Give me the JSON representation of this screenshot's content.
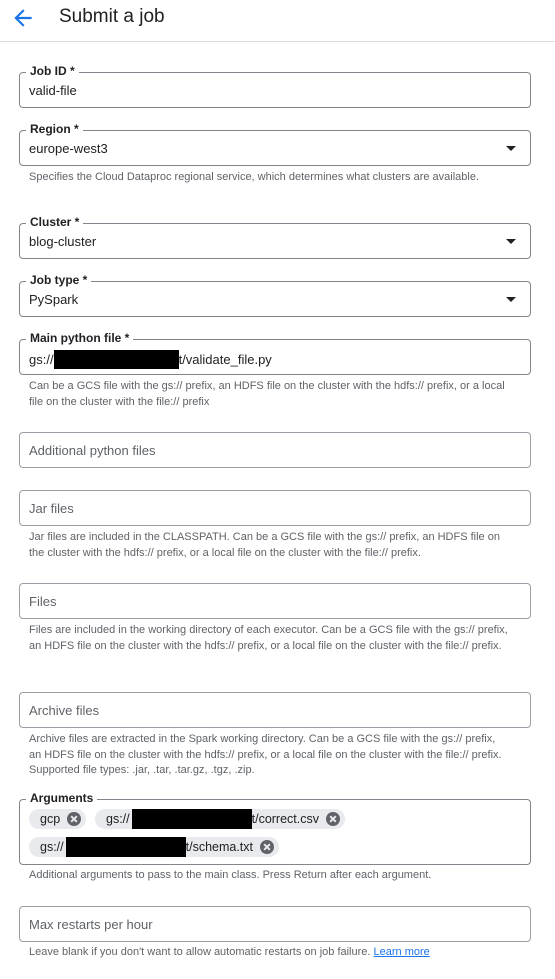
{
  "header": {
    "title": "Submit a job"
  },
  "job_id": {
    "label": "Job ID *",
    "value": "valid-file"
  },
  "region": {
    "label": "Region *",
    "value": "europe-west3",
    "hint": "Specifies the Cloud Dataproc regional service, which determines what clusters are available."
  },
  "cluster": {
    "label": "Cluster *",
    "value": "blog-cluster"
  },
  "job_type": {
    "label": "Job type *",
    "value": "PySpark"
  },
  "main_python_file": {
    "label": "Main python file *",
    "value_prefix": "gs://",
    "value_suffix": "t/validate_file.py",
    "hint": "Can be a GCS file with the gs:// prefix, an HDFS file on the cluster with the hdfs:// prefix, or a local file on the cluster with the file:// prefix"
  },
  "additional_python_files": {
    "placeholder": "Additional python files"
  },
  "jar_files": {
    "placeholder": "Jar files",
    "hint": "Jar files are included in the CLASSPATH. Can be a GCS file with the gs:// prefix, an HDFS file on the cluster with the hdfs:// prefix, or a local file on the cluster with the file:// prefix."
  },
  "files": {
    "placeholder": "Files",
    "hint": "Files are included in the working directory of each executor. Can be a GCS file with the gs:// prefix, an HDFS file on the cluster with the hdfs:// prefix, or a local file on the cluster with the file:// prefix."
  },
  "archive_files": {
    "placeholder": "Archive files",
    "hint": "Archive files are extracted in the Spark working directory. Can be a GCS file with the gs:// prefix, an HDFS file on the cluster with the hdfs:// prefix, or a local file on the cluster with the file:// prefix. Supported file types: .jar, .tar, .tar.gz, .tgz, .zip."
  },
  "arguments": {
    "label": "Arguments",
    "chips": [
      {
        "prefix": "gcp",
        "suffix": ""
      },
      {
        "prefix": "gs://",
        "suffix": "t/correct.csv"
      },
      {
        "prefix": "gs://",
        "suffix": "t/schema.txt"
      }
    ],
    "hint": "Additional arguments to pass to the main class. Press Return after each argument."
  },
  "max_restarts": {
    "placeholder": "Max restarts per hour",
    "hint": "Leave blank if you don't want to allow automatic restarts on job failure. ",
    "link": "Learn more"
  },
  "colors": {
    "accent": "#1a73e8",
    "border": "#80868b",
    "chip": "#e8eaed"
  }
}
